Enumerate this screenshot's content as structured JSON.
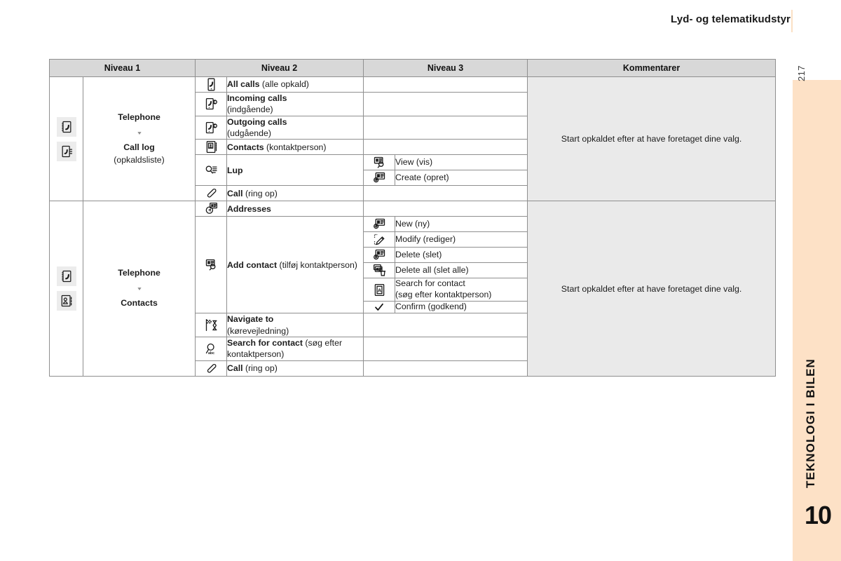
{
  "header": {
    "title": "Lyd- og telematikudstyr"
  },
  "sidebar": {
    "page_number": "217",
    "chapter_title": "TEKNOLOGI I BILEN",
    "chapter_number": "10",
    "band_color": "#fde1c6"
  },
  "table": {
    "columns": [
      "Niveau 1",
      "Niveau 2",
      "Niveau 3",
      "Kommentarer"
    ],
    "sections": [
      {
        "niveau1": {
          "icons": [
            "phonebook-icon",
            "call-log-icon"
          ],
          "title": "Telephone",
          "arrow": "down-arrow-icon",
          "subtitle": "Call log",
          "subtitle_note": "(opkaldsliste)"
        },
        "comment": "Start opkaldet efter at have foretaget dine valg.",
        "rows": [
          {
            "icon": "all-calls-icon",
            "label_bold": "All calls",
            "label_rest": " (alle opkald)",
            "niveau3": []
          },
          {
            "icon": "incoming-calls-icon",
            "label_bold": "Incoming calls",
            "label_rest": "(indgående)",
            "two_line": true,
            "niveau3": []
          },
          {
            "icon": "outgoing-calls-icon",
            "label_bold": "Outgoing calls",
            "label_rest": "(udgående)",
            "two_line": true,
            "niveau3": []
          },
          {
            "icon": "contacts-icon",
            "label_bold": "Contacts",
            "label_rest": " (kontaktperson)",
            "niveau3": []
          },
          {
            "icon": "lup-icon",
            "label_bold": "Lup",
            "label_rest": "",
            "niveau3": [
              {
                "icon": "view-contact-icon",
                "label": "View (vis)"
              },
              {
                "icon": "create-contact-icon",
                "label": "Create (opret)"
              }
            ]
          },
          {
            "icon": "handset-icon",
            "label_bold": "Call",
            "label_rest": " (ring op)",
            "niveau3": []
          }
        ]
      },
      {
        "niveau1": {
          "icons": [
            "phonebook-icon",
            "contacts-book-icon"
          ],
          "title": "Telephone",
          "arrow": "down-arrow-icon",
          "subtitle": "Contacts",
          "subtitle_note": ""
        },
        "comment": "Start opkaldet efter at have foretaget dine valg.",
        "rows": [
          {
            "icon": "addresses-icon",
            "label_bold": "Addresses",
            "label_rest": "",
            "niveau3": []
          },
          {
            "icon": "add-contact-icon",
            "label_bold": "Add contact",
            "label_rest": " (tilføj kontaktperson)",
            "niveau3": [
              {
                "icon": "new-contact-icon",
                "label": "New (ny)"
              },
              {
                "icon": "modify-icon",
                "label": "Modify (rediger)"
              },
              {
                "icon": "delete-contact-icon",
                "label": "Delete (slet)"
              },
              {
                "icon": "delete-all-icon",
                "label": "Delete all (slet alle)"
              },
              {
                "icon": "search-contact-icon",
                "label": "Search for contact",
                "label2": "(søg efter kontaktperson)"
              },
              {
                "icon": "check-icon",
                "label": "Confirm (godkend)"
              }
            ]
          },
          {
            "icon": "navigate-to-icon",
            "label_bold": "Navigate to",
            "label_rest": "(kørevejledning)",
            "two_line": true,
            "niveau3": []
          },
          {
            "icon": "search-abc-icon",
            "label_bold": "Search for contact",
            "label_rest": " (søg efter kontaktperson)",
            "niveau3": []
          },
          {
            "icon": "handset-icon",
            "label_bold": "Call",
            "label_rest": " (ring op)",
            "niveau3": []
          }
        ]
      }
    ]
  }
}
